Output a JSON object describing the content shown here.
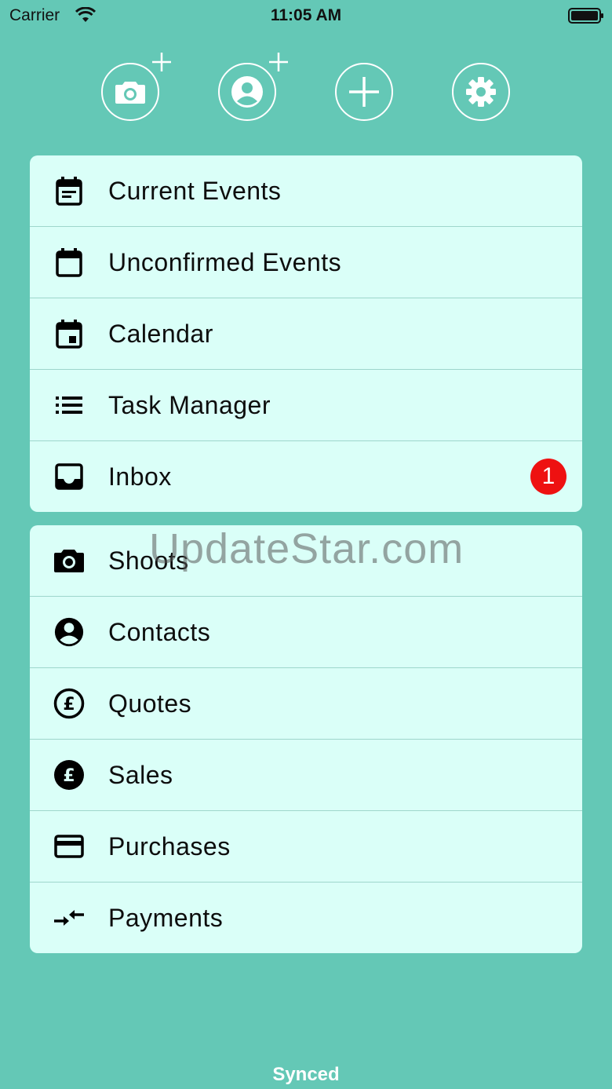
{
  "status_bar": {
    "carrier": "Carrier",
    "time": "11:05 AM"
  },
  "toolbar": {
    "buttons": [
      {
        "icon": "add-photo-icon"
      },
      {
        "icon": "add-contact-icon"
      },
      {
        "icon": "plus-icon"
      },
      {
        "icon": "gear-icon"
      }
    ]
  },
  "menu_primary": {
    "items": [
      {
        "label": "Current Events",
        "icon": "event-note-icon"
      },
      {
        "label": "Unconfirmed Events",
        "icon": "calendar-blank-icon"
      },
      {
        "label": "Calendar",
        "icon": "calendar-today-icon"
      },
      {
        "label": "Task Manager",
        "icon": "list-icon"
      },
      {
        "label": "Inbox",
        "icon": "inbox-icon",
        "badge": "1"
      }
    ]
  },
  "menu_secondary": {
    "items": [
      {
        "label": "Shoots",
        "icon": "camera-icon"
      },
      {
        "label": "Contacts",
        "icon": "account-circle-icon"
      },
      {
        "label": "Quotes",
        "icon": "pound-outline-icon"
      },
      {
        "label": "Sales",
        "icon": "pound-filled-icon"
      },
      {
        "label": "Purchases",
        "icon": "credit-card-icon"
      },
      {
        "label": "Payments",
        "icon": "transfer-arrows-icon"
      }
    ]
  },
  "watermark": "UpdateStar.com",
  "footer": {
    "sync_status": "Synced"
  },
  "colors": {
    "background": "#64c8b6",
    "card": "#dafff8",
    "badge": "#ee1111"
  }
}
